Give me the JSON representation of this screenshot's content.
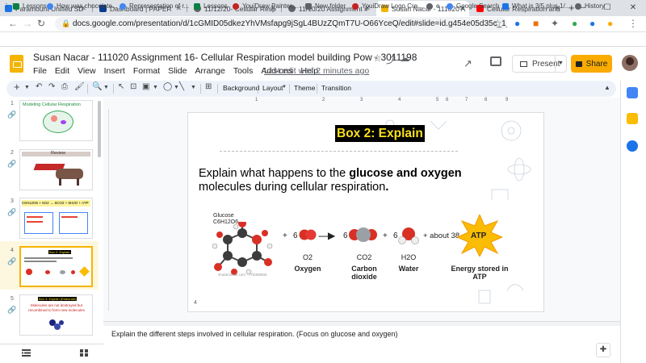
{
  "browser": {
    "tabs": [
      {
        "label": "Paramount Unified SD",
        "color": "#1a73e8"
      },
      {
        "label": "Dashboard | PAPER",
        "color": "#0a3a8f"
      },
      {
        "label": "11/12/20- Cellular Resp",
        "color": "#5f6368"
      },
      {
        "label": "11/10/20 Assignment #",
        "color": "#5f6368"
      },
      {
        "label": "Susan Nacar - 111020 A",
        "color": "#f4b400"
      },
      {
        "label": "Cellular Respiration and",
        "color": "#ff0000"
      }
    ],
    "new_tab": "+",
    "url": "docs.google.com/presentation/d/1cGMID05dkezYhVMsfapg9jSgL4BUzZQmT7U-O66YceQ/edit#slide=id.g454e05d35c_1_2199",
    "bookmarks": [
      "Lessons",
      "How was chocolate...",
      "Representation of r...",
      "Lessons",
      "YouiDraw Painter,...",
      "New folder",
      "YouiDraw Logo Cre...",
      "e",
      "Google Search",
      "What is 3/5 plus 1/...",
      "History"
    ]
  },
  "app": {
    "title": "Susan Nacar - 111020 Assignment 16- Cellular Respiration model building Pow - 3011198",
    "menu": [
      "File",
      "Edit",
      "View",
      "Insert",
      "Format",
      "Slide",
      "Arrange",
      "Tools",
      "Add-ons",
      "Help"
    ],
    "last_edit": "Last edit was 2 minutes ago",
    "present_label": "Present",
    "share_label": "Share",
    "accent": "#f9ab00"
  },
  "toolbar": {
    "background": "Background",
    "layout": "Layout",
    "theme": "Theme",
    "transition": "Transition"
  },
  "ruler": [
    "1",
    "2",
    "3",
    "4",
    "5",
    "6",
    "7",
    "8",
    "9"
  ],
  "filmstrip": [
    {
      "num": "1",
      "title": "Modeling Cellular Respiration"
    },
    {
      "num": "2",
      "title": "Review"
    },
    {
      "num": "3",
      "title": "C6H12O6 + 6O2 → 6CO2 + 6H2O + ATP"
    },
    {
      "num": "4",
      "title": "Box 2: Explain"
    },
    {
      "num": "5",
      "title": "Box 3: Explain (Elaborate)",
      "text": "Molecules are not destroyed but recombined to form new molecules"
    }
  ],
  "slide": {
    "title": "Box 2: Explain",
    "question_pre": "Explain what happens to the ",
    "question_bold": "glucose and oxygen",
    "question_post": " molecules during cellular respiration",
    "question_end": ".",
    "page_number": "4",
    "diagram": {
      "glucose_label": "Glucose",
      "glucose_formula": "C6H12O6",
      "plus": "+",
      "coef_o2": "6",
      "coef_co2": "6",
      "coef_h2o": "6",
      "about": "+ about 38",
      "atp": "ATP",
      "o2_formula": "O2",
      "co2_formula": "CO2",
      "h2o_formula": "H2O",
      "o2_name": "Oxygen",
      "co2_name": "Carbon dioxide",
      "h2o_name": "Water",
      "atp_name": "Energy stored in ATP",
      "credit": "shutterstock.com · 778398805"
    }
  },
  "notes": "Explain the different steps involved in cellular respiration. (Focus on glucose and oxygen)"
}
